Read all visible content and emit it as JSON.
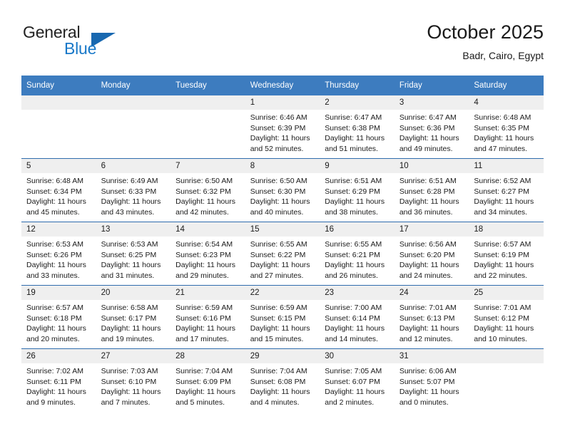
{
  "brand": {
    "line1": "General",
    "line2": "Blue",
    "triangle_color": "#1868b0",
    "accent_color": "#1878c8"
  },
  "header": {
    "title": "October 2025",
    "subtitle": "Badr, Cairo, Egypt"
  },
  "colors": {
    "header_band": "#3d7cbf",
    "row_divider": "#2f6cad",
    "date_band": "#efefef",
    "text": "#1a1a1a"
  },
  "weekday_headers": [
    "Sunday",
    "Monday",
    "Tuesday",
    "Wednesday",
    "Thursday",
    "Friday",
    "Saturday"
  ],
  "weeks": [
    [
      {
        "date": "",
        "lines": []
      },
      {
        "date": "",
        "lines": []
      },
      {
        "date": "",
        "lines": []
      },
      {
        "date": "1",
        "lines": [
          "Sunrise: 6:46 AM",
          "Sunset: 6:39 PM",
          "Daylight: 11 hours",
          "and 52 minutes."
        ]
      },
      {
        "date": "2",
        "lines": [
          "Sunrise: 6:47 AM",
          "Sunset: 6:38 PM",
          "Daylight: 11 hours",
          "and 51 minutes."
        ]
      },
      {
        "date": "3",
        "lines": [
          "Sunrise: 6:47 AM",
          "Sunset: 6:36 PM",
          "Daylight: 11 hours",
          "and 49 minutes."
        ]
      },
      {
        "date": "4",
        "lines": [
          "Sunrise: 6:48 AM",
          "Sunset: 6:35 PM",
          "Daylight: 11 hours",
          "and 47 minutes."
        ]
      }
    ],
    [
      {
        "date": "5",
        "lines": [
          "Sunrise: 6:48 AM",
          "Sunset: 6:34 PM",
          "Daylight: 11 hours",
          "and 45 minutes."
        ]
      },
      {
        "date": "6",
        "lines": [
          "Sunrise: 6:49 AM",
          "Sunset: 6:33 PM",
          "Daylight: 11 hours",
          "and 43 minutes."
        ]
      },
      {
        "date": "7",
        "lines": [
          "Sunrise: 6:50 AM",
          "Sunset: 6:32 PM",
          "Daylight: 11 hours",
          "and 42 minutes."
        ]
      },
      {
        "date": "8",
        "lines": [
          "Sunrise: 6:50 AM",
          "Sunset: 6:30 PM",
          "Daylight: 11 hours",
          "and 40 minutes."
        ]
      },
      {
        "date": "9",
        "lines": [
          "Sunrise: 6:51 AM",
          "Sunset: 6:29 PM",
          "Daylight: 11 hours",
          "and 38 minutes."
        ]
      },
      {
        "date": "10",
        "lines": [
          "Sunrise: 6:51 AM",
          "Sunset: 6:28 PM",
          "Daylight: 11 hours",
          "and 36 minutes."
        ]
      },
      {
        "date": "11",
        "lines": [
          "Sunrise: 6:52 AM",
          "Sunset: 6:27 PM",
          "Daylight: 11 hours",
          "and 34 minutes."
        ]
      }
    ],
    [
      {
        "date": "12",
        "lines": [
          "Sunrise: 6:53 AM",
          "Sunset: 6:26 PM",
          "Daylight: 11 hours",
          "and 33 minutes."
        ]
      },
      {
        "date": "13",
        "lines": [
          "Sunrise: 6:53 AM",
          "Sunset: 6:25 PM",
          "Daylight: 11 hours",
          "and 31 minutes."
        ]
      },
      {
        "date": "14",
        "lines": [
          "Sunrise: 6:54 AM",
          "Sunset: 6:23 PM",
          "Daylight: 11 hours",
          "and 29 minutes."
        ]
      },
      {
        "date": "15",
        "lines": [
          "Sunrise: 6:55 AM",
          "Sunset: 6:22 PM",
          "Daylight: 11 hours",
          "and 27 minutes."
        ]
      },
      {
        "date": "16",
        "lines": [
          "Sunrise: 6:55 AM",
          "Sunset: 6:21 PM",
          "Daylight: 11 hours",
          "and 26 minutes."
        ]
      },
      {
        "date": "17",
        "lines": [
          "Sunrise: 6:56 AM",
          "Sunset: 6:20 PM",
          "Daylight: 11 hours",
          "and 24 minutes."
        ]
      },
      {
        "date": "18",
        "lines": [
          "Sunrise: 6:57 AM",
          "Sunset: 6:19 PM",
          "Daylight: 11 hours",
          "and 22 minutes."
        ]
      }
    ],
    [
      {
        "date": "19",
        "lines": [
          "Sunrise: 6:57 AM",
          "Sunset: 6:18 PM",
          "Daylight: 11 hours",
          "and 20 minutes."
        ]
      },
      {
        "date": "20",
        "lines": [
          "Sunrise: 6:58 AM",
          "Sunset: 6:17 PM",
          "Daylight: 11 hours",
          "and 19 minutes."
        ]
      },
      {
        "date": "21",
        "lines": [
          "Sunrise: 6:59 AM",
          "Sunset: 6:16 PM",
          "Daylight: 11 hours",
          "and 17 minutes."
        ]
      },
      {
        "date": "22",
        "lines": [
          "Sunrise: 6:59 AM",
          "Sunset: 6:15 PM",
          "Daylight: 11 hours",
          "and 15 minutes."
        ]
      },
      {
        "date": "23",
        "lines": [
          "Sunrise: 7:00 AM",
          "Sunset: 6:14 PM",
          "Daylight: 11 hours",
          "and 14 minutes."
        ]
      },
      {
        "date": "24",
        "lines": [
          "Sunrise: 7:01 AM",
          "Sunset: 6:13 PM",
          "Daylight: 11 hours",
          "and 12 minutes."
        ]
      },
      {
        "date": "25",
        "lines": [
          "Sunrise: 7:01 AM",
          "Sunset: 6:12 PM",
          "Daylight: 11 hours",
          "and 10 minutes."
        ]
      }
    ],
    [
      {
        "date": "26",
        "lines": [
          "Sunrise: 7:02 AM",
          "Sunset: 6:11 PM",
          "Daylight: 11 hours",
          "and 9 minutes."
        ]
      },
      {
        "date": "27",
        "lines": [
          "Sunrise: 7:03 AM",
          "Sunset: 6:10 PM",
          "Daylight: 11 hours",
          "and 7 minutes."
        ]
      },
      {
        "date": "28",
        "lines": [
          "Sunrise: 7:04 AM",
          "Sunset: 6:09 PM",
          "Daylight: 11 hours",
          "and 5 minutes."
        ]
      },
      {
        "date": "29",
        "lines": [
          "Sunrise: 7:04 AM",
          "Sunset: 6:08 PM",
          "Daylight: 11 hours",
          "and 4 minutes."
        ]
      },
      {
        "date": "30",
        "lines": [
          "Sunrise: 7:05 AM",
          "Sunset: 6:07 PM",
          "Daylight: 11 hours",
          "and 2 minutes."
        ]
      },
      {
        "date": "31",
        "lines": [
          "Sunrise: 6:06 AM",
          "Sunset: 5:07 PM",
          "Daylight: 11 hours",
          "and 0 minutes."
        ]
      },
      {
        "date": "",
        "lines": []
      }
    ]
  ]
}
